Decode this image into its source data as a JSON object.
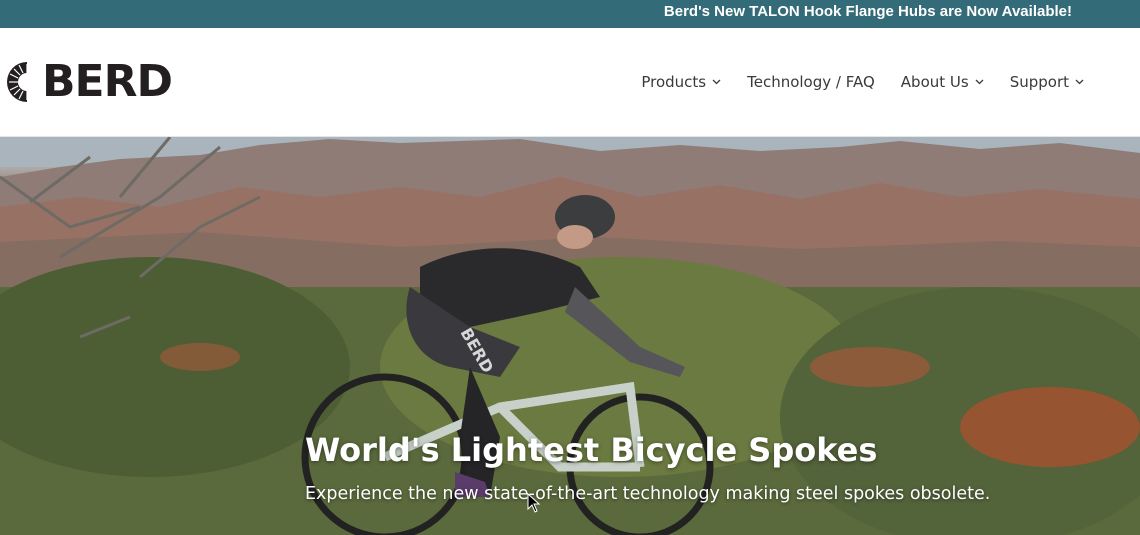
{
  "announcement": {
    "text": "Berd's New TALON Hook Flange Hubs are Now Available!"
  },
  "header": {
    "logo_text": "BERD",
    "nav": [
      {
        "label": "Products",
        "has_dropdown": true
      },
      {
        "label": "Technology / FAQ",
        "has_dropdown": false
      },
      {
        "label": "About Us",
        "has_dropdown": true
      },
      {
        "label": "Support",
        "has_dropdown": true
      }
    ]
  },
  "hero": {
    "title": "World's Lightest Bicycle Spokes",
    "subtitle": "Experience the new state-of-the-art technology making steel spokes obsolete.",
    "jersey_text": "BERD"
  },
  "colors": {
    "announcement_bg": "#336b78",
    "text_dark": "#231f20",
    "nav_text": "#3a3a3a"
  }
}
